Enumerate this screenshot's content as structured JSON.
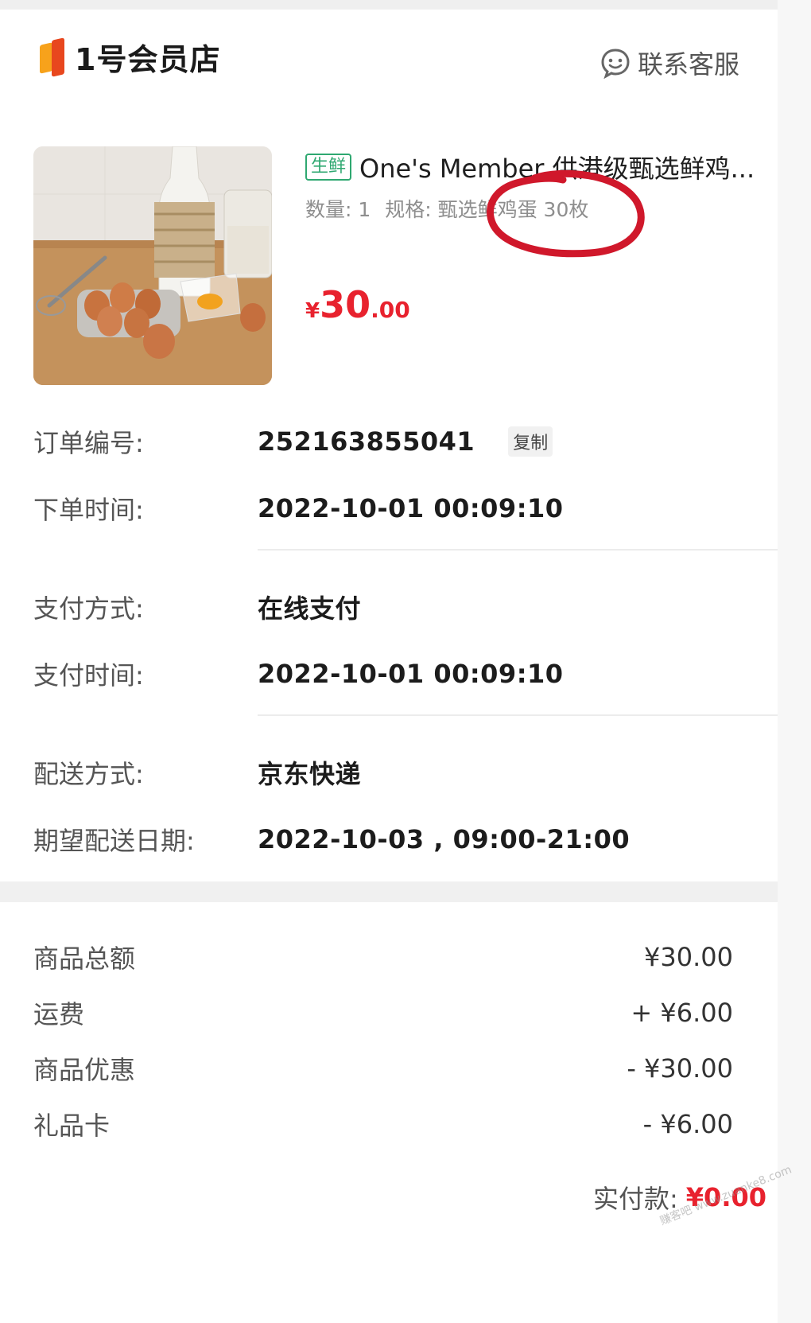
{
  "header": {
    "logo_text": "1号会员店",
    "service_label": "联系客服"
  },
  "product": {
    "tag": "生鲜",
    "title": "One's Member 供港级甄选鲜鸡...",
    "quantity": "数量: 1",
    "spec": "规格: 甄选鲜鸡蛋 30枚",
    "price_currency": "¥",
    "price_integer": "30",
    "price_decimal": ".00"
  },
  "order": {
    "number_label": "订单编号:",
    "number_value": "252163855041",
    "copy_label": "复制",
    "time_label": "下单时间:",
    "time_value": "2022-10-01 00:09:10",
    "pay_method_label": "支付方式:",
    "pay_method_value": "在线支付",
    "pay_time_label": "支付时间:",
    "pay_time_value": "2022-10-01 00:09:10",
    "delivery_method_label": "配送方式:",
    "delivery_method_value": "京东快递",
    "delivery_date_label": "期望配送日期:",
    "delivery_date_value": "2022-10-03 , 09:00-21:00"
  },
  "totals": {
    "items": [
      {
        "label": "商品总额",
        "value": "¥30.00"
      },
      {
        "label": "运费",
        "value": "+ ¥6.00"
      },
      {
        "label": "商品优惠",
        "value": "- ¥30.00"
      },
      {
        "label": "礼品卡",
        "value": "- ¥6.00"
      }
    ],
    "paid_label": "实付款:",
    "paid_value": "¥0.00"
  },
  "watermark": "赚客吧 www.zuanke8.com",
  "colors": {
    "price_red": "#e8222e",
    "fresh_green": "#2fa871",
    "annotation_red": "#d0182b"
  }
}
